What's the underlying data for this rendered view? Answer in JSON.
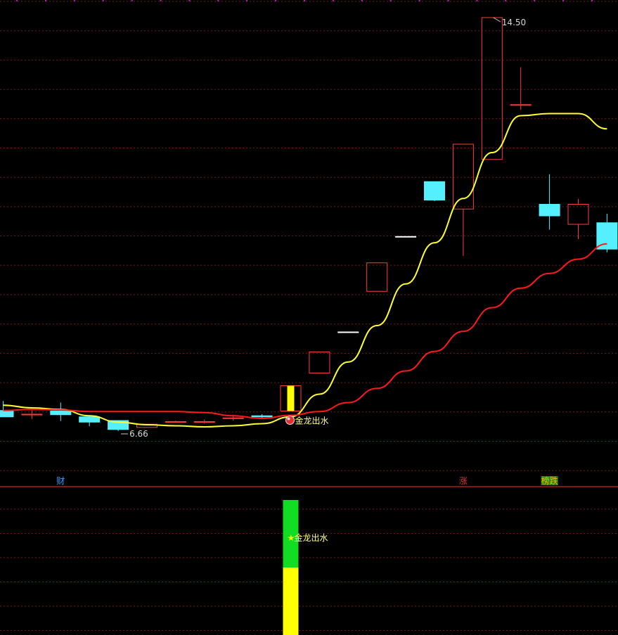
{
  "chart_data": {
    "type": "candlestick",
    "main_panel": {
      "ylim": [
        5.5,
        14.8
      ],
      "max_annotation": "14.50",
      "min_annotation": "6.66",
      "candles": [
        {
          "o": 7.05,
          "h": 7.23,
          "l": 6.93,
          "c": 6.93,
          "up": false
        },
        {
          "o": 6.98,
          "h": 7.06,
          "l": 6.89,
          "c": 6.98,
          "up": true
        },
        {
          "o": 7.04,
          "h": 7.2,
          "l": 6.85,
          "c": 6.97,
          "up": false
        },
        {
          "o": 6.93,
          "h": 6.94,
          "l": 6.75,
          "c": 6.83,
          "up": false
        },
        {
          "o": 6.86,
          "h": 6.86,
          "l": 6.66,
          "c": 6.69,
          "up": false
        },
        {
          "o": 6.73,
          "h": 6.79,
          "l": 6.73,
          "c": 6.79,
          "up": true
        },
        {
          "o": 6.84,
          "h": 6.86,
          "l": 6.82,
          "c": 6.84,
          "up": true
        },
        {
          "o": 6.84,
          "h": 6.88,
          "l": 6.8,
          "c": 6.84,
          "up": true
        },
        {
          "o": 6.91,
          "h": 6.97,
          "l": 6.86,
          "c": 6.91,
          "up": true
        },
        {
          "o": 6.95,
          "h": 6.98,
          "l": 6.9,
          "c": 6.93,
          "up": false
        },
        {
          "o": 7.04,
          "h": 7.52,
          "l": 7.04,
          "c": 7.52,
          "up": true
        },
        {
          "o": 7.76,
          "h": 8.16,
          "l": 7.76,
          "c": 8.16,
          "up": true
        },
        {
          "o": 8.54,
          "h": 8.54,
          "l": 8.54,
          "c": 8.54,
          "up": true
        },
        {
          "o": 9.31,
          "h": 9.85,
          "l": 9.31,
          "c": 9.85,
          "up": true
        },
        {
          "o": 10.35,
          "h": 10.35,
          "l": 10.35,
          "c": 10.35,
          "up": true
        },
        {
          "o": 11.39,
          "h": 11.39,
          "l": 11.02,
          "c": 11.04,
          "up": false
        },
        {
          "o": 10.87,
          "h": 12.1,
          "l": 9.98,
          "c": 12.1,
          "up": true
        },
        {
          "o": 11.81,
          "h": 14.5,
          "l": 11.81,
          "c": 14.5,
          "up": true
        },
        {
          "o": 12.85,
          "h": 13.56,
          "l": 12.75,
          "c": 12.85,
          "up": true
        },
        {
          "o": 10.96,
          "h": 11.53,
          "l": 10.48,
          "c": 10.74,
          "up": false
        },
        {
          "o": 10.96,
          "h": 11.06,
          "l": 10.3,
          "c": 10.58,
          "up": true
        },
        {
          "o": 10.61,
          "h": 10.78,
          "l": 10.05,
          "c": 10.11,
          "up": false
        }
      ],
      "yellow_ma": [
        7.15,
        7.1,
        7.07,
        6.95,
        6.83,
        6.78,
        6.76,
        6.74,
        6.76,
        6.8,
        6.93,
        7.36,
        7.97,
        8.66,
        9.45,
        10.23,
        11.07,
        11.94,
        12.64,
        12.68,
        12.68,
        12.39
      ],
      "red_ma": [
        7.05,
        7.07,
        7.06,
        7.03,
        7.03,
        7.03,
        7.03,
        7.01,
        6.95,
        6.9,
        6.96,
        7.03,
        7.2,
        7.47,
        7.8,
        8.17,
        8.55,
        9.0,
        9.37,
        9.65,
        9.92,
        10.21
      ],
      "signal_label": "金龙出水"
    },
    "marker_row": [
      {
        "index": 2,
        "text": "财",
        "color": "#3aa0ff"
      },
      {
        "index": 16,
        "text": "涨",
        "color": "#d63a3a"
      },
      {
        "index": 19,
        "text": "榜跌",
        "color": "#ffb400",
        "bg": "#1a8a1a"
      }
    ],
    "sub_panel": {
      "signal_index": 10,
      "bar_top_fraction": 0.5,
      "signal_label": "金龙出水"
    }
  },
  "colors": {
    "up": "#ff3b3b",
    "down": "#55f0ff",
    "neutral": "#ffffff",
    "yellow_ma": "#ffff33",
    "red_ma": "#ff1a1a",
    "grid": "#7a1818",
    "divider": "#b01c1c",
    "green_bar": "#11dd22",
    "yellow_bar": "#ffff00",
    "label_text": "#ffff80"
  },
  "icons": {
    "signal_ball": "red-ball-icon",
    "star": "yellow-star-icon"
  }
}
